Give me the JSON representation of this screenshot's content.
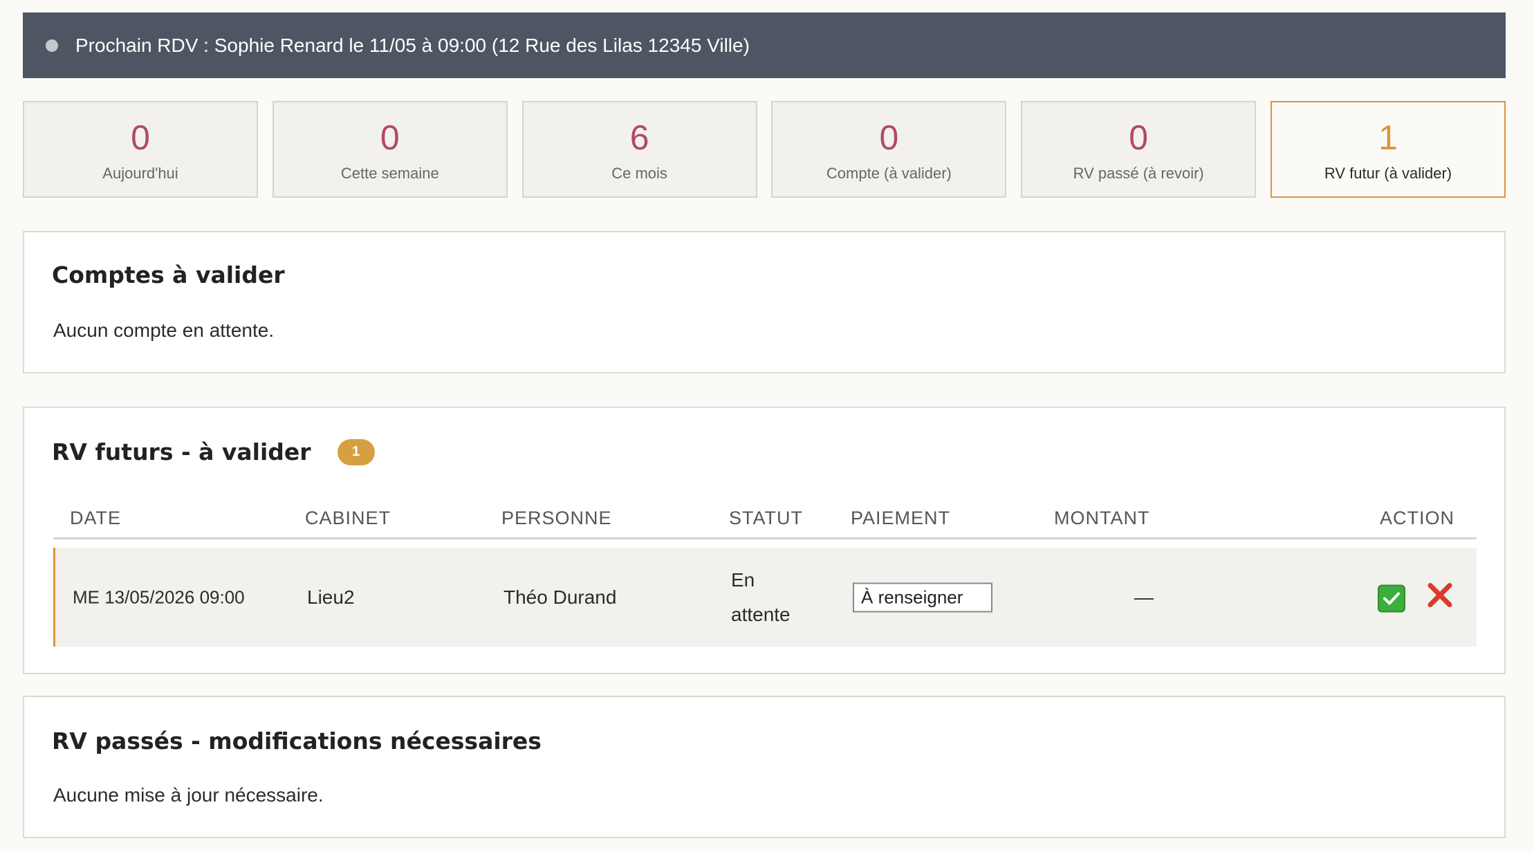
{
  "banner": {
    "text": "Prochain RDV : Sophie Renard le 11/05 à 09:00 (12 Rue des Lilas 12345 Ville)"
  },
  "stats": [
    {
      "value": "0",
      "label": "Aujourd'hui"
    },
    {
      "value": "0",
      "label": "Cette semaine"
    },
    {
      "value": "6",
      "label": "Ce mois"
    },
    {
      "value": "0",
      "label": "Compte (à valider)"
    },
    {
      "value": "0",
      "label": "RV passé (à revoir)"
    },
    {
      "value": "1",
      "label": "RV futur (à valider)"
    }
  ],
  "accounts": {
    "title": "Comptes à valider",
    "empty": "Aucun compte en attente."
  },
  "future": {
    "title": "RV futurs - à valider",
    "badge": "1",
    "columns": [
      "DATE",
      "CABINET",
      "PERSONNE",
      "STATUT",
      "PAIEMENT",
      "MONTANT",
      "ACTION"
    ],
    "rows": [
      {
        "date": "ME 13/05/2026 09:00",
        "cabinet": "Lieu2",
        "personne": "Théo Durand",
        "statut_line1": "En",
        "statut_line2": "attente",
        "paiement": "À renseigner",
        "montant": "—"
      }
    ]
  },
  "past": {
    "title": "RV passés - modifications nécessaires",
    "empty": "Aucune mise à jour nécessaire."
  },
  "colors": {
    "banner_bg": "#4e5663",
    "stat_number": "#b04a68",
    "accent": "#d9953a",
    "badge": "#d6a040",
    "ok": "#3cae3c",
    "cancel": "#d93a2b"
  },
  "icons": {
    "validate": "check-mark-icon",
    "reject": "cross-icon"
  }
}
